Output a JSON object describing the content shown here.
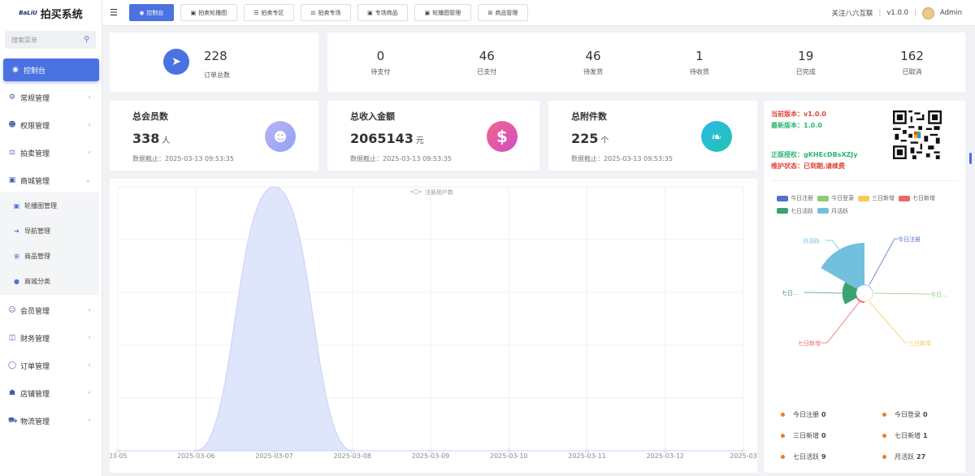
{
  "app": {
    "logo_mark": "BaLiU",
    "title": "拍买系统"
  },
  "search": {
    "placeholder": "搜索菜单"
  },
  "menu": [
    {
      "label": "控制台",
      "icon": "dashboard-icon"
    },
    {
      "label": "常规管理",
      "icon": "cogs-icon"
    },
    {
      "label": "权限管理",
      "icon": "users-icon"
    },
    {
      "label": "拍卖管理",
      "icon": "gavel-icon"
    },
    {
      "label": "商城管理",
      "icon": "shop-icon"
    },
    {
      "label": "会员管理",
      "icon": "user-circle-icon"
    },
    {
      "label": "财务管理",
      "icon": "money-icon"
    },
    {
      "label": "订单管理",
      "icon": "order-icon"
    },
    {
      "label": "店铺管理",
      "icon": "bank-icon"
    },
    {
      "label": "物流管理",
      "icon": "truck-icon"
    }
  ],
  "submenu": [
    {
      "label": "轮播图管理",
      "icon": "image-icon"
    },
    {
      "label": "导航管理",
      "icon": "arrow-right-icon"
    },
    {
      "label": "商品管理",
      "icon": "plus-square-icon"
    },
    {
      "label": "商城分类",
      "icon": "circle-icon"
    }
  ],
  "tabs": [
    {
      "label": "控制台",
      "icon": "dashboard-icon"
    },
    {
      "label": "拍卖轮播图",
      "icon": "image-icon"
    },
    {
      "label": "拍卖专区",
      "icon": "list-icon"
    },
    {
      "label": "拍卖专场",
      "icon": "gavel-icon"
    },
    {
      "label": "专场商品",
      "icon": "shop-icon"
    },
    {
      "label": "轮播图管理",
      "icon": "image-icon"
    },
    {
      "label": "商品管理",
      "icon": "plus-square-icon"
    }
  ],
  "topbar": {
    "follow": "关注八六互联",
    "version": "v1.0.0",
    "user": "Admin"
  },
  "orders_total": {
    "value": "228",
    "label": "订单总数"
  },
  "order_stats": [
    {
      "value": "0",
      "label": "待支付"
    },
    {
      "value": "46",
      "label": "已支付"
    },
    {
      "value": "46",
      "label": "待发货"
    },
    {
      "value": "1",
      "label": "待收货"
    },
    {
      "value": "19",
      "label": "已完成"
    },
    {
      "value": "162",
      "label": "已取消"
    }
  ],
  "members": {
    "title": "总会员数",
    "value": "338",
    "unit": "人",
    "note": "数据截止：2025-03-13 09:53:35"
  },
  "revenue": {
    "title": "总收入金额",
    "value": "2065143",
    "unit": "元",
    "note": "数据截止：2025-03-13 09:53:35"
  },
  "attachments": {
    "title": "总附件数",
    "value": "225",
    "unit": "个",
    "note": "数据截止：2025-03-13 09:53:35"
  },
  "version_info": {
    "current": "当前版本：v1.0.0",
    "latest": "最新版本：1.0.0",
    "license": "正版授权：gKHEcDBsXZJy",
    "status": "维护状态：已到期,请续费"
  },
  "colors": {
    "accent": "#4a72e0",
    "area_fill": "#dfe5fb",
    "area_line": "#c8d2f6"
  },
  "chart_data": [
    {
      "type": "area",
      "legend": [
        "注册用户数"
      ],
      "x": [
        "03-05",
        "2025-03-06",
        "2025-03-07",
        "2025-03-08",
        "2025-03-09",
        "2025-03-10",
        "2025-03-11",
        "2025-03-12",
        "2025-03"
      ],
      "series": [
        {
          "name": "注册用户数",
          "values": [
            0,
            0,
            1,
            0,
            0,
            0,
            0,
            0,
            0
          ]
        }
      ]
    },
    {
      "type": "pie",
      "legend": [
        "今日注册",
        "今日登录",
        "三日新增",
        "七日新增",
        "七日活跃",
        "月活跃"
      ],
      "legend_colors": [
        "#5470c6",
        "#91cc75",
        "#fac858",
        "#ee6666",
        "#3ba272",
        "#73c0de"
      ],
      "labels": [
        "今日注册",
        "今日...",
        "三日新增",
        "七日新增",
        "七日...",
        "月活跃"
      ],
      "values": [
        0,
        0,
        0,
        1,
        9,
        27
      ]
    }
  ],
  "user_stats": [
    {
      "label": "今日注册",
      "value": "0"
    },
    {
      "label": "今日登录",
      "value": "0"
    },
    {
      "label": "三日新增",
      "value": "0"
    },
    {
      "label": "七日新增",
      "value": "1"
    },
    {
      "label": "七日活跃",
      "value": "9"
    },
    {
      "label": "月活跃",
      "value": "27"
    }
  ]
}
